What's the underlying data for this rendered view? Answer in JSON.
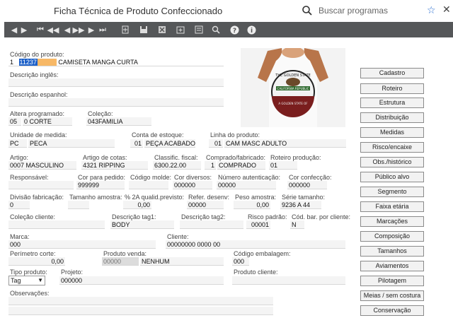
{
  "window": {
    "title": "Ficha Técnica de Produto Confeccionado"
  },
  "search": {
    "placeholder": "Buscar programas"
  },
  "toolbar": {
    "icons": [
      "first-icon",
      "prev-icon",
      "first-alt-icon",
      "prev-alt-icon",
      "next-icon",
      "last-icon",
      "new-icon",
      "save-icon",
      "delete-icon",
      "copy-icon",
      "list-icon",
      "zoom-icon",
      "help-icon",
      "info-icon"
    ]
  },
  "form": {
    "codigo_label": "Código do produto:",
    "codigo_prefix": "1",
    "codigo_value": "11237",
    "codigo_desc": "CAMISETA MANGA CURTA",
    "desc_ingles_label": "Descrição inglês:",
    "desc_espanhol_label": "Descrição espanhol:",
    "altera_label": "Altera programado:",
    "altera_code": "05",
    "altera_value": "0 CORTE",
    "colecao_label": "Coleção:",
    "colecao_value": "043FAMILIA",
    "unidade_label": "Unidade de medida:",
    "unidade_code": "PC",
    "unidade_value": "PECA",
    "conta_label": "Conta de estoque:",
    "conta_code": "01",
    "conta_value": "PEÇA ACABADO",
    "linha_label": "Linha do produto:",
    "linha_code": "01",
    "linha_value": "CAM MASC ADULTO",
    "artigo_label": "Artigo:",
    "artigo_value": "0007 MASCULINO",
    "artigo_cotas_label": "Artigo de cotas:",
    "artigo_cotas_value": "4321 RIPPING",
    "classif_label": "Classific. fiscal:",
    "classif_value": "6300.22.00",
    "comprado_label": "Comprado/fabricado:",
    "comprado_code": "1",
    "comprado_value": "COMPRADO",
    "roteiro_label": "Roteiro produção:",
    "roteiro_value": "01",
    "responsavel_label": "Responsável:",
    "cor_pedido_label": "Cor para pedido:",
    "cor_pedido_value": "999999",
    "codigo_molde_label": "Código molde:",
    "cor_diversos_label": "Cor diversos:",
    "cor_diversos_value": "000000",
    "numero_aut_label": "Número autenticação:",
    "numero_aut_value": "00000",
    "cor_confeccao_label": "Cor confecção:",
    "cor_confeccao_value": "000000",
    "divisao_label": "Divisão fabricação:",
    "divisao_value": "0",
    "tamanho_label": "Tamanho amostra:",
    "qualid_label": "% 2A qualid.previsto:",
    "qualid_value": "0,00",
    "refer_label": "Refer. desenv:",
    "refer_value": "00000",
    "peso_label": "Peso amostra:",
    "peso_value": "0,00",
    "serie_label": "Série tamanho:",
    "serie_value": "9236 A 44",
    "colecao_cliente_label": "Coleção cliente:",
    "desc_tag1_label": "Descrição tag1:",
    "desc_tag1_value": "BODY",
    "desc_tag2_label": "Descrição tag2:",
    "risco_label": "Risco padrão:",
    "risco_value": "00001",
    "cod_bar_label": "Cód. bar. por cliente:",
    "cod_bar_value": "N",
    "marca_label": "Marca:",
    "marca_value": "000",
    "cliente_label": "Cliente:",
    "cliente_value": "00000000 0000 00",
    "perimetro_label": "Perímetro corte:",
    "perimetro_value": "0,00",
    "produto_venda_label": "Produto venda:",
    "produto_venda_code": "00000",
    "produto_venda_value": "NENHUM",
    "codigo_emb_label": "Código embalagem:",
    "codigo_emb_value": "000",
    "tipo_label": "Tipo produto:",
    "tipo_value": "Tag",
    "projeto_label": "Projeto:",
    "projeto_value": "000000",
    "produto_cliente_label": "Produto cliente:",
    "observacoes_label": "Observações:"
  },
  "buttons": [
    "Cadastro",
    "Roteiro",
    "Estrutura",
    "Distribuição",
    "Medidas",
    "Risco/encaixe",
    "Obs./histórico",
    "Público alvo",
    "Segmento",
    "Faixa etária",
    "Marcações",
    "Composição",
    "Tamanhos",
    "Aviamentos",
    "Pilotagem",
    "Meias / sem costura",
    "Conservação"
  ],
  "photo": {
    "shirt_text_top": "THE GOLDEN STATE",
    "shirt_text_mid": "CALIFORNIA REPUBLIC",
    "shirt_text_bot": "A GOLDEN STATE OF"
  }
}
